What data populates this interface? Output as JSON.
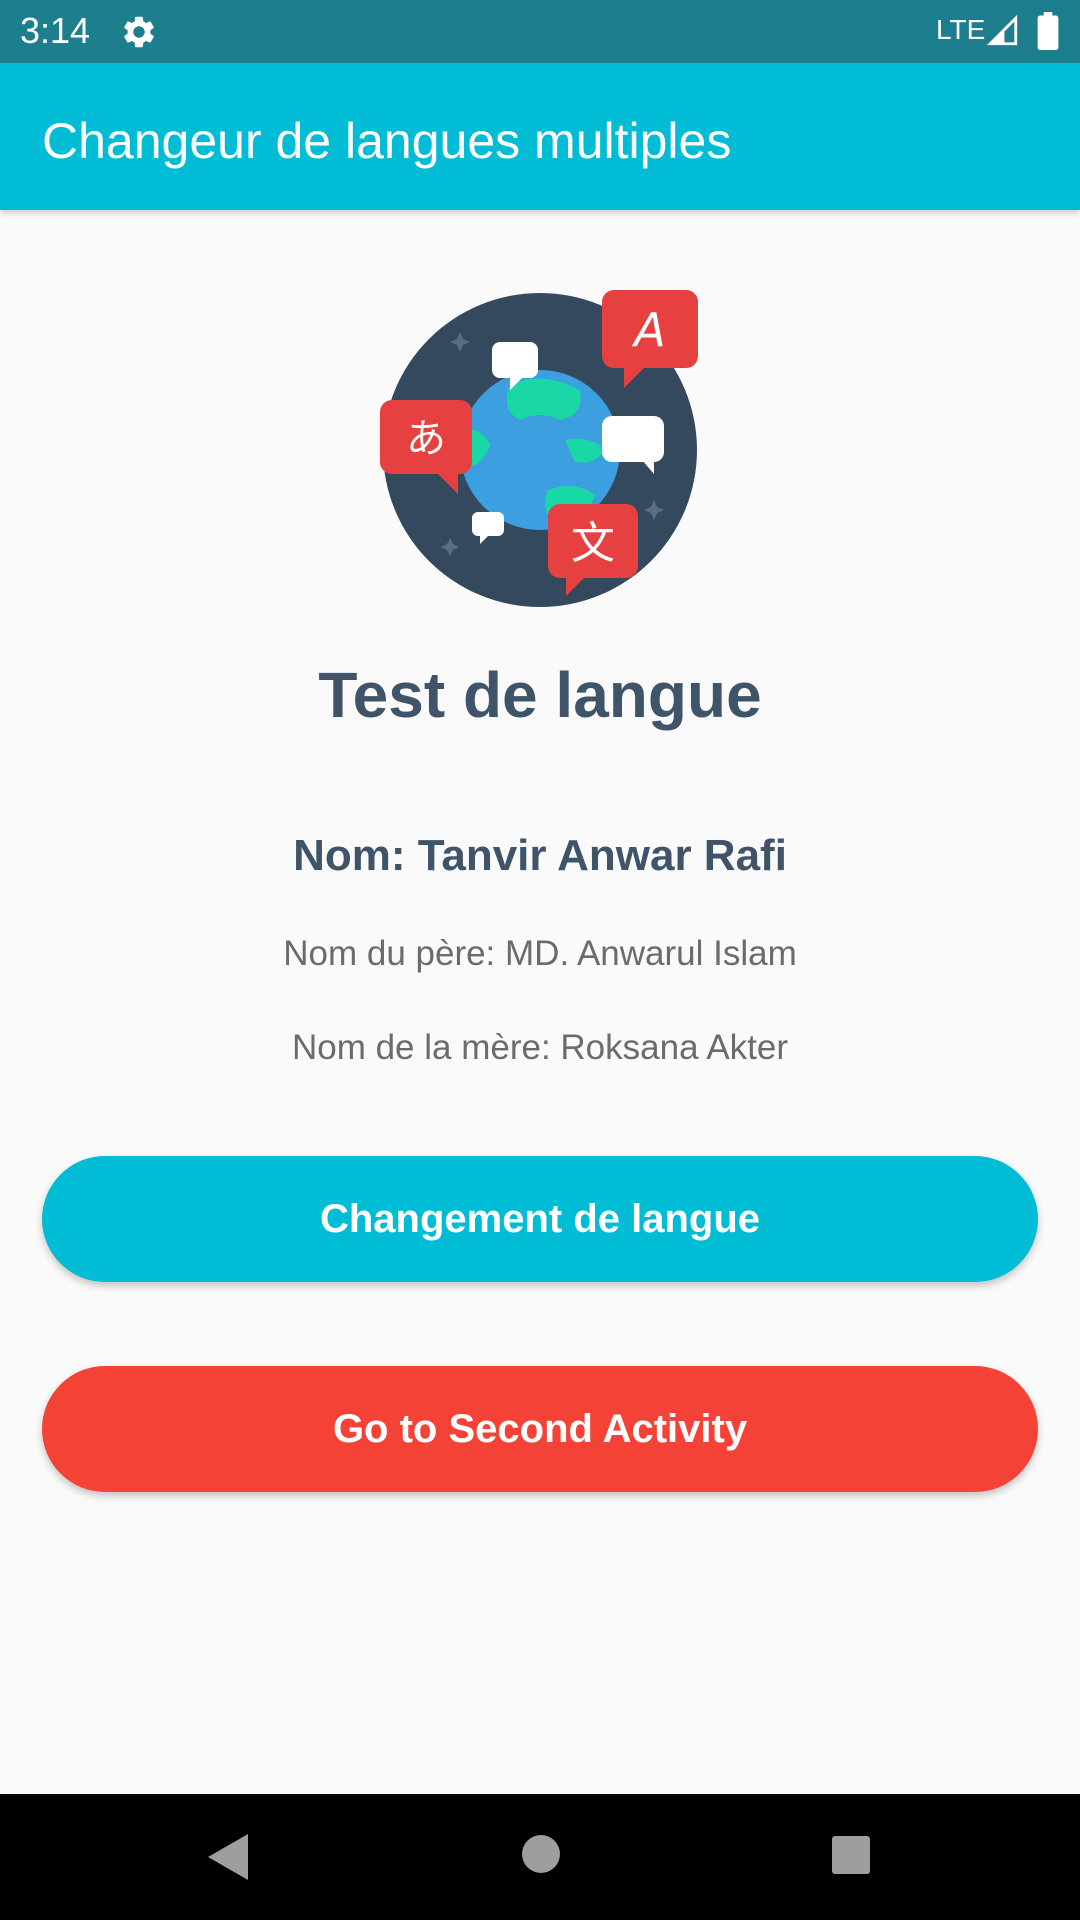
{
  "status_bar": {
    "time": "3:14",
    "network": "LTE",
    "icons": [
      "gear-icon",
      "signal-icon",
      "battery-icon"
    ]
  },
  "app_bar": {
    "title": "Changeur de langues multiples",
    "color": "#00bcd4"
  },
  "hero": {
    "icon": "globe-languages-icon",
    "glyphs": [
      "A",
      "あ",
      "文"
    ]
  },
  "content": {
    "heading": "Test de langue",
    "name": "Nom: Tanvir Anwar Rafi",
    "father": "Nom du père: MD. Anwarul Islam",
    "mother": "Nom de la mère: Roksana Akter"
  },
  "buttons": {
    "change_language": "Changement de langue",
    "second_activity": "Go to Second Activity"
  },
  "colors": {
    "primary": "#00bcd4",
    "status_bar": "#1d7f8e",
    "accent_red": "#f44336",
    "text_dark": "#3f5468",
    "text_muted": "#6b6b6b"
  },
  "nav_bar": {
    "icons": [
      "back-icon",
      "home-icon",
      "recents-icon"
    ]
  }
}
